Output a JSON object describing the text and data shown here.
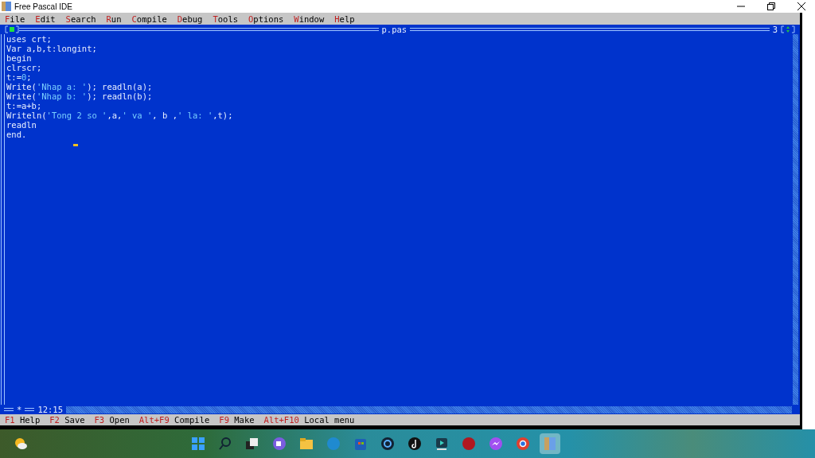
{
  "window": {
    "title": "Free Pascal IDE"
  },
  "menu": [
    {
      "key": "F",
      "rest": "ile"
    },
    {
      "key": "E",
      "rest": "dit"
    },
    {
      "key": "S",
      "rest": "earch"
    },
    {
      "key": "R",
      "rest": "un"
    },
    {
      "key": "C",
      "rest": "ompile"
    },
    {
      "key": "D",
      "rest": "ebug"
    },
    {
      "key": "T",
      "rest": "ools"
    },
    {
      "key": "O",
      "rest": "ptions"
    },
    {
      "key": "W",
      "rest": "indow"
    },
    {
      "key": "H",
      "rest": "elp"
    }
  ],
  "editor": {
    "title": "p.pas",
    "window_number": "3",
    "modified_marker": "*",
    "position": "12:15",
    "lines": [
      [
        {
          "kind": "plain",
          "text": "uses crt;"
        }
      ],
      [
        {
          "kind": "plain",
          "text": "Var a,b,t:longint;"
        }
      ],
      [
        {
          "kind": "plain",
          "text": "begin"
        }
      ],
      [
        {
          "kind": "plain",
          "text": "clrscr;"
        }
      ],
      [
        {
          "kind": "plain",
          "text": "t:="
        },
        {
          "kind": "number",
          "text": "0"
        },
        {
          "kind": "plain",
          "text": ";"
        }
      ],
      [
        {
          "kind": "plain",
          "text": "Write("
        },
        {
          "kind": "string",
          "text": "'Nhap a: '"
        },
        {
          "kind": "plain",
          "text": "); readln(a);"
        }
      ],
      [
        {
          "kind": "plain",
          "text": "Write("
        },
        {
          "kind": "string",
          "text": "'Nhap b: '"
        },
        {
          "kind": "plain",
          "text": "); readln(b);"
        }
      ],
      [
        {
          "kind": "plain",
          "text": "t:=a+b;"
        }
      ],
      [
        {
          "kind": "plain",
          "text": "Writeln("
        },
        {
          "kind": "string",
          "text": "'Tong 2 so '"
        },
        {
          "kind": "plain",
          "text": ",a,"
        },
        {
          "kind": "string",
          "text": "' va '"
        },
        {
          "kind": "plain",
          "text": ", b ,"
        },
        {
          "kind": "string",
          "text": "' la: '"
        },
        {
          "kind": "plain",
          "text": ",t);"
        }
      ],
      [
        {
          "kind": "plain",
          "text": "readln"
        }
      ],
      [
        {
          "kind": "plain",
          "text": "end."
        }
      ]
    ]
  },
  "status_bar": [
    {
      "key": "F1",
      "label": "Help"
    },
    {
      "key": "F2",
      "label": "Save"
    },
    {
      "key": "F3",
      "label": "Open"
    },
    {
      "key": "Alt+F9",
      "label": "Compile"
    },
    {
      "key": "F9",
      "label": "Make"
    },
    {
      "key": "Alt+F10",
      "label": "Local menu"
    }
  ]
}
